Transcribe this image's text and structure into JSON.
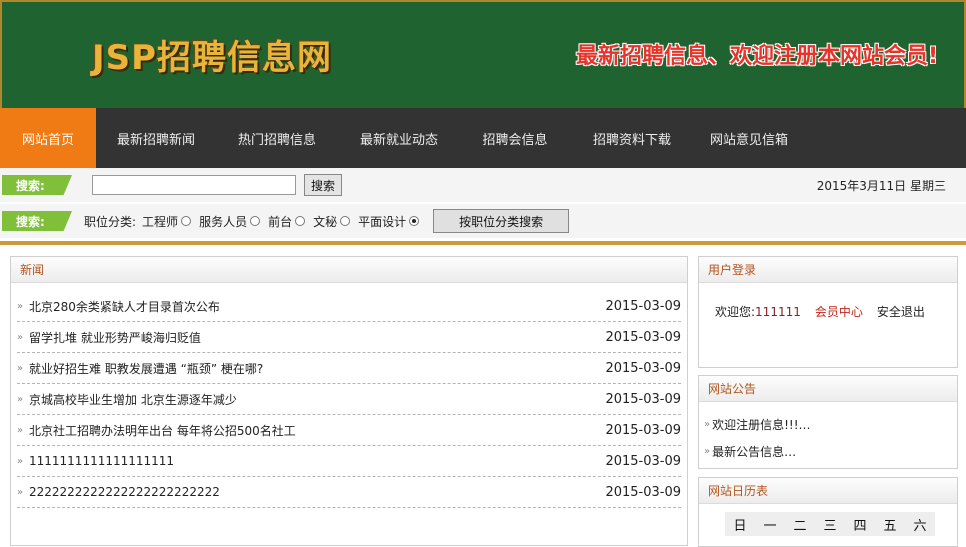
{
  "header": {
    "logo": "JSP招聘信息网",
    "slogan": "最新招聘信息、欢迎注册本网站会员!"
  },
  "nav": {
    "items": [
      "网站首页",
      "最新招聘新闻",
      "热门招聘信息",
      "最新就业动态",
      "招聘会信息",
      "招聘资料下载",
      "网站意见信箱"
    ],
    "active": 0
  },
  "search": {
    "label": "搜索:",
    "input_value": "",
    "button": "搜索",
    "date": "2015年3月11日  星期三"
  },
  "category": {
    "label": "搜索:",
    "prefix": "职位分类:",
    "options": [
      "工程师",
      "服务人员",
      "前台",
      "文秘",
      "平面设计"
    ],
    "selected": 4,
    "button": "按职位分类搜索"
  },
  "news": {
    "title": "新闻",
    "items": [
      {
        "title": "北京280余类紧缺人才目录首次公布",
        "date": "2015-03-09"
      },
      {
        "title": "留学扎堆 就业形势严峻海归贬值",
        "date": "2015-03-09"
      },
      {
        "title": "就业好招生难 职教发展遭遇 “瓶颈” 梗在哪?",
        "date": "2015-03-09"
      },
      {
        "title": "京城高校毕业生增加 北京生源逐年减少",
        "date": "2015-03-09"
      },
      {
        "title": "北京社工招聘办法明年出台 每年将公招500名社工",
        "date": "2015-03-09"
      },
      {
        "title": "1111111111111111111",
        "date": "2015-03-09"
      },
      {
        "title": "2222222222222222222222222",
        "date": "2015-03-09"
      }
    ]
  },
  "login": {
    "title": "用户登录",
    "welcome": "欢迎您:",
    "username": "111111",
    "member_center": "会员中心",
    "logout": "安全退出"
  },
  "notice": {
    "title": "网站公告",
    "items": [
      "欢迎注册信息!!!…",
      "最新公告信息…"
    ]
  },
  "calendar": {
    "title": "网站日历表",
    "weekdays": [
      "日",
      "一",
      "二",
      "三",
      "四",
      "五",
      "六"
    ]
  },
  "colors": {
    "header_bg": "#1f6331",
    "nav_bg": "#333333",
    "nav_active": "#f07a14",
    "tag_green": "#7fbf3a",
    "panel_title": "#b3541e"
  }
}
